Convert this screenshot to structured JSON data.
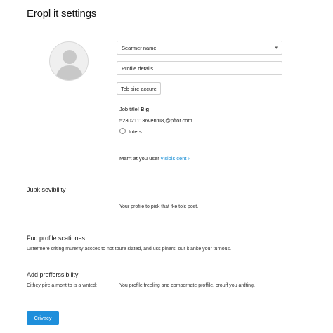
{
  "header": {
    "title": "Eropl it settings"
  },
  "profile": {
    "avatar_icon": "user-silhouette-icon",
    "select": {
      "value": "Searmer name",
      "icon": "chevron-down-icon"
    },
    "input": {
      "value": "Profile details"
    },
    "button": {
      "label": "Teb sire accure"
    },
    "job_title_label": "Job title!",
    "job_title_value": "Big",
    "contact": "5230211136ventu8,@pftor.com",
    "radio_label": "Inters",
    "manage_text": "Marrt at you user",
    "manage_link": "visibls cent",
    "manage_link_icon": "chevron-right-icon"
  },
  "sections": {
    "visibility": {
      "title": "Jubk sevibility",
      "text": "Your profile to pisk that fke tols post."
    },
    "scatones": {
      "title": "Fud profile scationes",
      "text": "Ustermere criting murerity accces to not toure slated, and uss piners, our it anke your turnous."
    },
    "preferences": {
      "title": "Add prefferssibility",
      "left_text": "Cithey pire a mont to is a wnted:",
      "right_text": "You profile freeling and compornate proffile, crouff you ardting."
    }
  },
  "footer": {
    "primary_button": "Crivacy"
  },
  "colors": {
    "accent": "#1f8fdb",
    "link": "#1a8fd6"
  }
}
